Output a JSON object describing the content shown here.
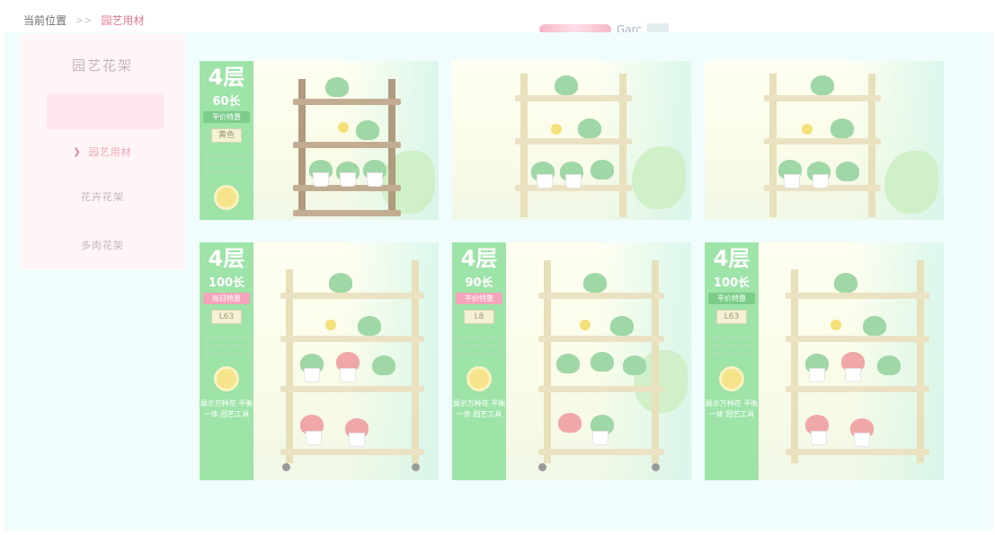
{
  "breadcrumb": {
    "label": "当前位置",
    "separator": ">>",
    "current": "园艺用材"
  },
  "header": {
    "user_name": "Garc"
  },
  "sidebar": {
    "title": "园艺花架",
    "items": [
      {
        "label": "园艺用材",
        "icon": "chevron-right-icon",
        "active": true
      },
      {
        "label": "花卉花架",
        "active": false
      },
      {
        "label": "多肉花架",
        "active": false
      }
    ]
  },
  "products": [
    {
      "tiers": "4层",
      "length": "60长",
      "tag": "平价特惠",
      "badge": "黄色",
      "footer_text": "",
      "accent": "#9ee3a8"
    },
    {
      "tiers": "",
      "length": "",
      "tag": "",
      "badge": "",
      "footer_text": "",
      "accent": "#9ee3a8"
    },
    {
      "tiers": "",
      "length": "",
      "tag": "",
      "badge": "",
      "footer_text": "",
      "accent": "#9ee3a8"
    },
    {
      "tiers": "4层",
      "length": "100长",
      "tag": "每日特惠",
      "badge": "L63",
      "footer_text": "展示万种花 平衡一体 园艺工具",
      "accent": "#9ee3a8"
    },
    {
      "tiers": "4层",
      "length": "90长",
      "tag": "平价特惠",
      "badge": "L8",
      "footer_text": "展示万种花 平衡一体 园艺工具",
      "accent": "#9ee3a8"
    },
    {
      "tiers": "4层",
      "length": "100长",
      "tag": "平价特惠",
      "badge": "L63",
      "footer_text": "展示万种花 平衡一体 园艺工具",
      "accent": "#9ee3a8"
    }
  ],
  "colors": {
    "page_bg": "#f1fdfd",
    "sidebar_bg": "#fff4f6",
    "accent_pink": "#e07b8f",
    "promo_green": "#9ee3a8"
  }
}
